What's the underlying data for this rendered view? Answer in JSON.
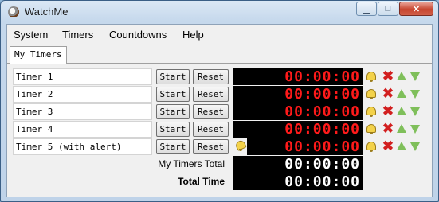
{
  "window": {
    "title": "WatchMe"
  },
  "menu": {
    "items": [
      "System",
      "Timers",
      "Countdowns",
      "Help"
    ]
  },
  "tabs": [
    {
      "label": "My Timers"
    }
  ],
  "timers": [
    {
      "name": "Timer 1",
      "start": "Start",
      "reset": "Reset",
      "time": "00:00:00",
      "alert": false
    },
    {
      "name": "Timer 2",
      "start": "Start",
      "reset": "Reset",
      "time": "00:00:00",
      "alert": false
    },
    {
      "name": "Timer 3",
      "start": "Start",
      "reset": "Reset",
      "time": "00:00:00",
      "alert": false
    },
    {
      "name": "Timer 4",
      "start": "Start",
      "reset": "Reset",
      "time": "00:00:00",
      "alert": false
    },
    {
      "name": "Timer 5 (with alert)",
      "start": "Start",
      "reset": "Reset",
      "time": "00:00:00",
      "alert": true
    }
  ],
  "totals": {
    "my_timers_label": "My Timers Total",
    "my_timers_value": "00:00:00",
    "total_label": "Total Time",
    "total_value": "00:00:00"
  },
  "colors": {
    "display_bg": "#000000",
    "timer_digits": "#ff1a1a",
    "total_digits": "#ffffff"
  }
}
